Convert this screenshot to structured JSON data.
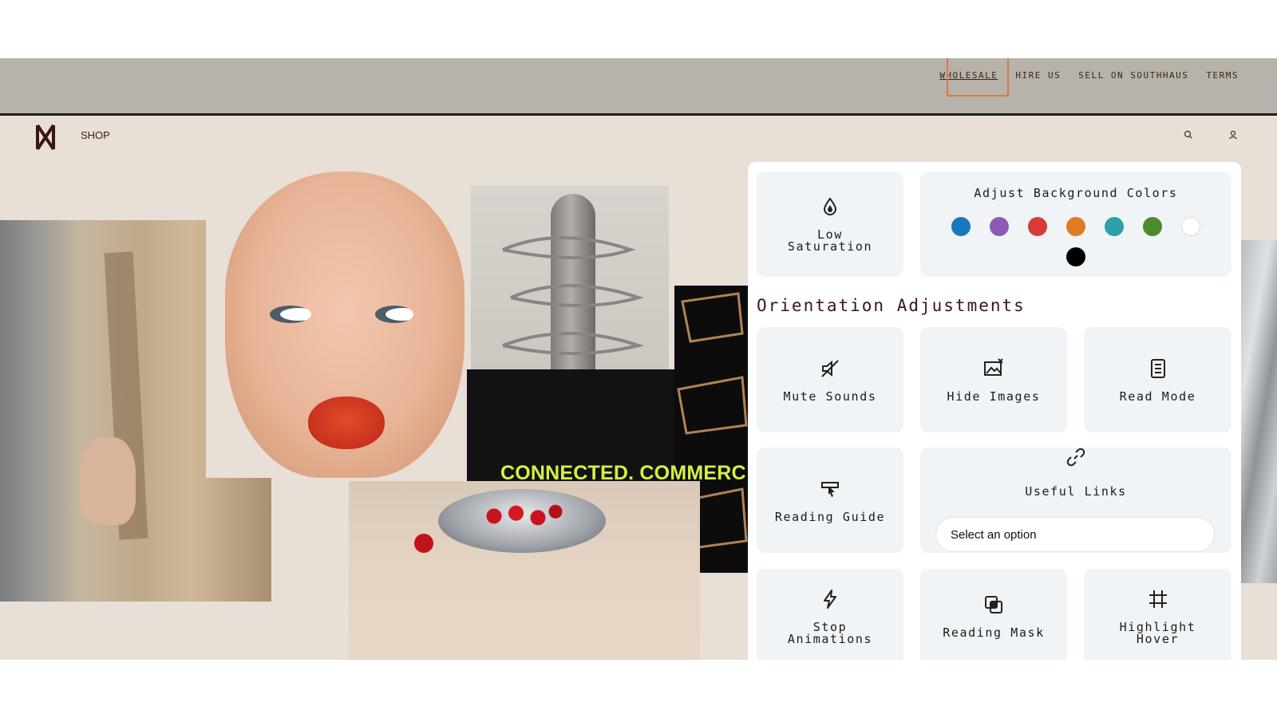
{
  "utility_nav": {
    "items": [
      {
        "label": "WHOLESALE",
        "active": true
      },
      {
        "label": "HIRE US"
      },
      {
        "label": "SELL ON SOUTHHAUS"
      },
      {
        "label": "TERMS"
      }
    ]
  },
  "header": {
    "logo_icon": "southhaus-logo-icon",
    "shop_label": "SHOP",
    "icons": [
      "search-icon",
      "user-icon"
    ]
  },
  "hero": {
    "tagline": "CONNECTED. COMMERC"
  },
  "accessibility_panel": {
    "low_saturation": {
      "label": "Low Saturation",
      "icon": "droplet-icon"
    },
    "background_colors": {
      "title": "Adjust Background Colors",
      "swatches": [
        "#1877bd",
        "#8d59b6",
        "#d83a3a",
        "#e07b22",
        "#2ba0a8",
        "#4d8a2c",
        "#ffffff",
        "#000000"
      ]
    },
    "orientation_title": "Orientation Adjustments",
    "mute_sounds": {
      "label": "Mute Sounds",
      "icon": "mute-icon"
    },
    "hide_images": {
      "label": "Hide Images",
      "icon": "hide-image-icon"
    },
    "read_mode": {
      "label": "Read Mode",
      "icon": "document-icon"
    },
    "reading_guide": {
      "label": "Reading Guide",
      "icon": "reading-guide-icon"
    },
    "useful_links": {
      "label": "Useful Links",
      "icon": "link-icon",
      "select_value": "Select an option"
    },
    "stop_animations": {
      "label": "Stop Animations",
      "icon": "lightning-icon"
    },
    "reading_mask": {
      "label": "Reading Mask",
      "icon": "mask-icon"
    },
    "highlight_hover": {
      "label": "Highlight Hover",
      "icon": "grid-hash-icon"
    }
  }
}
